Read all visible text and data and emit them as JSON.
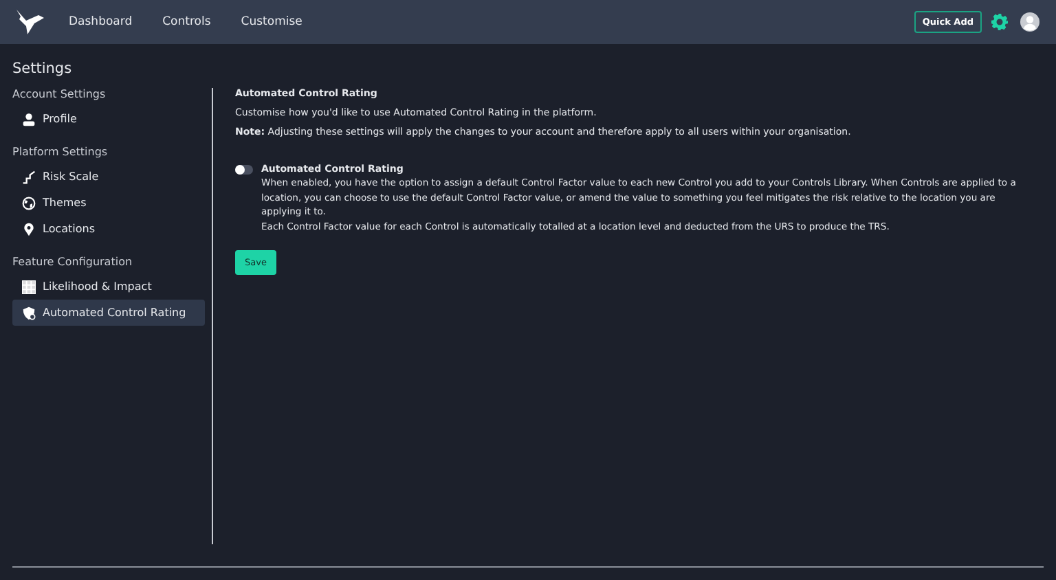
{
  "nav": [
    {
      "label": "Dashboard"
    },
    {
      "label": "Controls"
    },
    {
      "label": "Customise"
    }
  ],
  "quick_add": "Quick Add",
  "page_title": "Settings",
  "sidebar": [
    {
      "heading": "Account Settings",
      "items": [
        {
          "label": "Profile",
          "selected": false
        }
      ]
    },
    {
      "heading": "Platform Settings",
      "items": [
        {
          "label": "Risk Scale",
          "selected": false
        },
        {
          "label": "Themes",
          "selected": false
        },
        {
          "label": "Locations",
          "selected": false
        }
      ]
    },
    {
      "heading": "Feature Configuration",
      "items": [
        {
          "label": "Likelihood & Impact",
          "selected": false
        },
        {
          "label": "Automated Control Rating",
          "selected": true
        }
      ]
    }
  ],
  "content": {
    "title": "Automated Control Rating",
    "intro": "Customise how you'd like to use Automated Control Rating in the platform.",
    "note": "**Note:** Adjusting these settings will apply the changes to your account and therefore apply to all users within your organisation.",
    "toggle": {
      "label": "Automated Control Rating",
      "on": false,
      "description": [
        "When enabled, you have the option to assign a default Control Factor value to each new Control you add to your Controls Library. When Controls are applied to a location, you can choose to use the default Control Factor value, or amend the value to something you feel mitigates the risk relative to the location you are applying it to.",
        "Each Control Factor value for each Control is automatically totalled at a location level and deducted from the URS to produce the TRS."
      ]
    },
    "save": "Save"
  }
}
